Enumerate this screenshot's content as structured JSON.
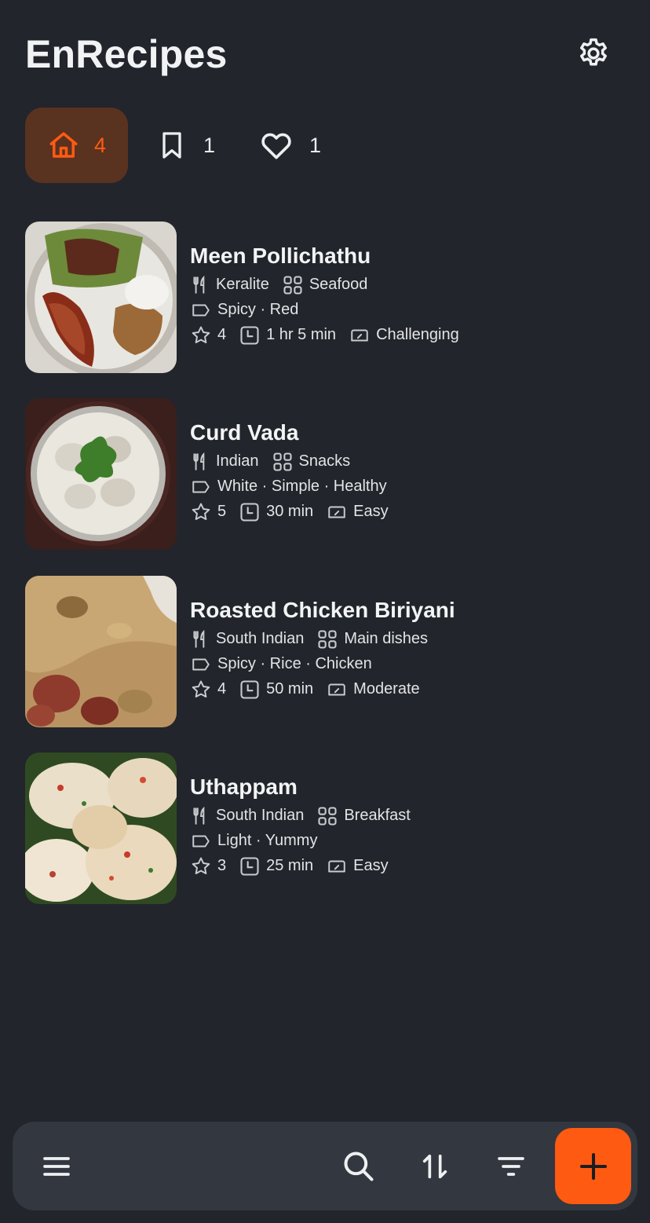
{
  "app": {
    "title": "EnRecipes"
  },
  "tabs": [
    {
      "id": "all",
      "icon": "home-icon",
      "count": "4",
      "active": true
    },
    {
      "id": "try-later",
      "icon": "bookmark-icon",
      "count": "1",
      "active": false
    },
    {
      "id": "favourites",
      "icon": "heart-icon",
      "count": "1",
      "active": false
    }
  ],
  "recipes": [
    {
      "title": "Meen Pollichathu",
      "cuisine": "Keralite",
      "category": "Seafood",
      "tags": "Spicy · Red",
      "rating": "4",
      "time": "1 hr 5 min",
      "difficulty": "Challenging"
    },
    {
      "title": "Curd Vada",
      "cuisine": "Indian",
      "category": "Snacks",
      "tags": "White · Simple · Healthy",
      "rating": "5",
      "time": "30 min",
      "difficulty": "Easy"
    },
    {
      "title": "Roasted Chicken Biriyani",
      "cuisine": "South Indian",
      "category": "Main dishes",
      "tags": "Spicy · Rice · Chicken",
      "rating": "4",
      "time": "50 min",
      "difficulty": "Moderate"
    },
    {
      "title": "Uthappam",
      "cuisine": "South Indian",
      "category": "Breakfast",
      "tags": "Light · Yummy",
      "rating": "3",
      "time": "25 min",
      "difficulty": "Easy"
    }
  ],
  "bottom_bar": {
    "icons": [
      "menu-icon",
      "search-icon",
      "sort-icon",
      "filter-icon",
      "plus-icon"
    ]
  },
  "colors": {
    "background": "#22252b",
    "accent": "#ff5a12",
    "active_tab_bg": "#5a3220",
    "bottom_bar_bg": "#33373f"
  }
}
